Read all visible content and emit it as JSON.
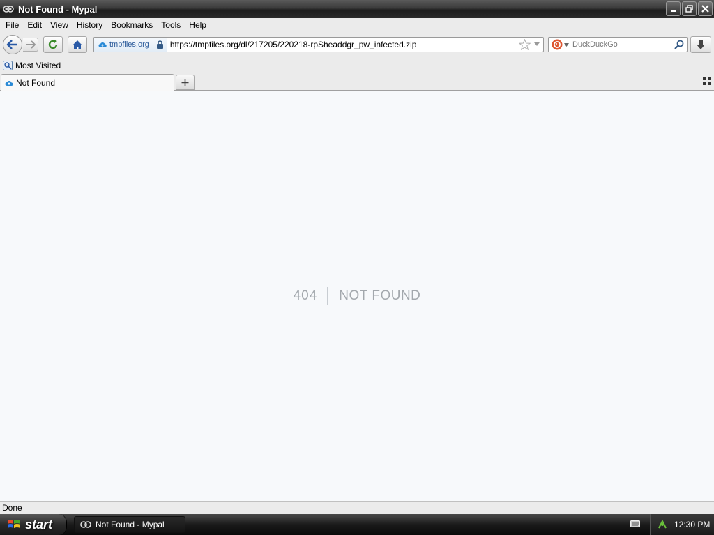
{
  "window": {
    "title": "Not Found - Mypal"
  },
  "menu": [
    {
      "pre": "",
      "u": "F",
      "post": "ile"
    },
    {
      "pre": "",
      "u": "E",
      "post": "dit"
    },
    {
      "pre": "",
      "u": "V",
      "post": "iew"
    },
    {
      "pre": "Hi",
      "u": "s",
      "post": "tory"
    },
    {
      "pre": "",
      "u": "B",
      "post": "ookmarks"
    },
    {
      "pre": "",
      "u": "T",
      "post": "ools"
    },
    {
      "pre": "",
      "u": "H",
      "post": "elp"
    }
  ],
  "navbar": {
    "identity": "tmpfiles.org",
    "url": "https://tmpfiles.org/dl/217205/220218-rpSheaddgr_pw_infected.zip",
    "search_placeholder": "DuckDuckGo"
  },
  "bookmarks": {
    "most_visited": "Most Visited"
  },
  "tabs": [
    {
      "label": "Not Found"
    }
  ],
  "page": {
    "code": "404",
    "message": "NOT FOUND"
  },
  "status": {
    "text": "Done"
  },
  "taskbar": {
    "start": "start",
    "task": "Not Found - Mypal",
    "clock": "12:30 PM"
  },
  "colors": {
    "content_bg": "#f7f9fb",
    "error_text": "#a3a8ad",
    "link_blue": "#2a5a9a"
  }
}
